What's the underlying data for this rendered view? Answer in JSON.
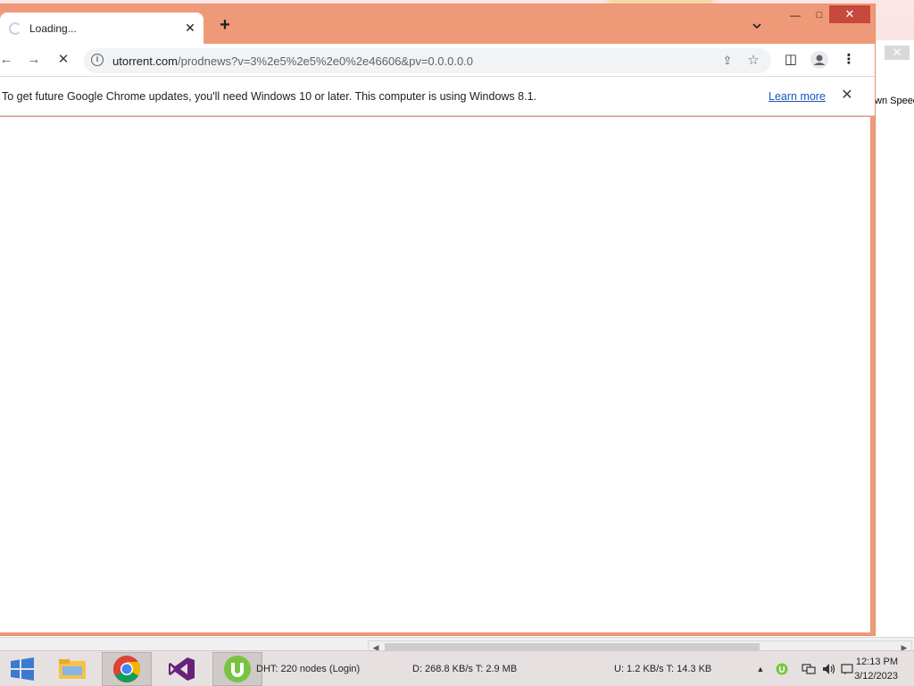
{
  "chrome": {
    "tab": {
      "title": "Loading...",
      "close": "✕"
    },
    "new_tab": "+",
    "window_controls": {
      "minimize": "—",
      "maximize": "□",
      "close": "✕"
    },
    "tab_search": "⌄",
    "toolbar": {
      "back": "←",
      "forward": "→",
      "stop": "✕",
      "share": "⇪",
      "bookmark": "☆",
      "side_panel": "◫",
      "menu": "⋮"
    },
    "omnibox": {
      "host": "utorrent.com",
      "path": "/prodnews?v=3%2e5%2e5%2e0%2e46606&pv=0.0.0.0.0",
      "info_icon": "i"
    },
    "infobar": {
      "message": "To get future Google Chrome updates, you'll need Windows 10 or later. This computer is using Windows 8.1.",
      "link": "Learn more",
      "close": "✕"
    }
  },
  "utorrent_window": {
    "close": "✕",
    "column_header": "wn Speed"
  },
  "utorrent_status": {
    "dht": "DHT: 220 nodes (Login)",
    "download": "D: 268.8 KB/s T: 2.9 MB",
    "upload": "U: 1.2 KB/s T: 14.3 KB"
  },
  "taskbar": {
    "tray_arrow": "▲",
    "clock": {
      "time": "12:13 PM",
      "date": "3/12/2023"
    }
  },
  "colors": {
    "chrome_frame": "#ee9a79",
    "close_red": "#c7483d",
    "link_blue": "#1a56b8"
  }
}
